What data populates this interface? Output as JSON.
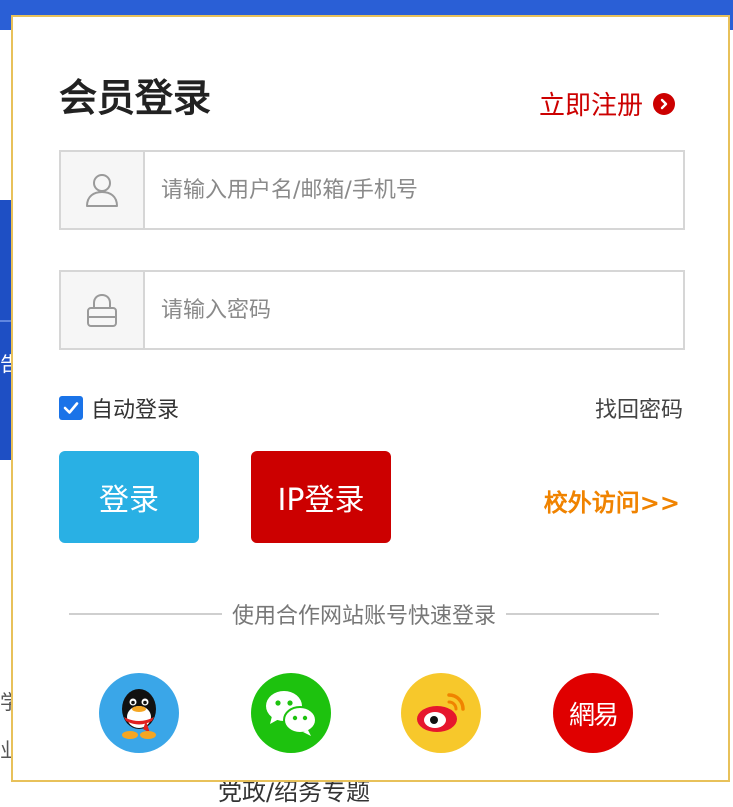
{
  "background": {
    "side_char_1": "告",
    "side_char_2": "学",
    "side_char_3": "业",
    "bottom_text": "党政/绍务专题"
  },
  "modal": {
    "title": "会员登录",
    "register_label": "立即注册",
    "username": {
      "placeholder": "请输入用户名/邮箱/手机号",
      "value": ""
    },
    "password": {
      "placeholder": "请输入密码",
      "value": ""
    },
    "auto_login_label": "自动登录",
    "auto_login_checked": true,
    "forgot_label": "找回密码",
    "login_button": "登录",
    "ip_login_button": "IP登录",
    "offsite_label": "校外访问>>",
    "divider_text": "使用合作网站账号快速登录",
    "netease_glyph": "網易"
  },
  "colors": {
    "accent_red": "#cc0000",
    "login_blue": "#29b0e4",
    "offsite_orange": "#f08300",
    "modal_border": "#e8c15a"
  },
  "icons": {
    "username": "user-icon",
    "password": "lock-icon",
    "register": "chevron-right-icon",
    "social": [
      "qq-icon",
      "wechat-icon",
      "weibo-icon",
      "netease-icon"
    ]
  }
}
